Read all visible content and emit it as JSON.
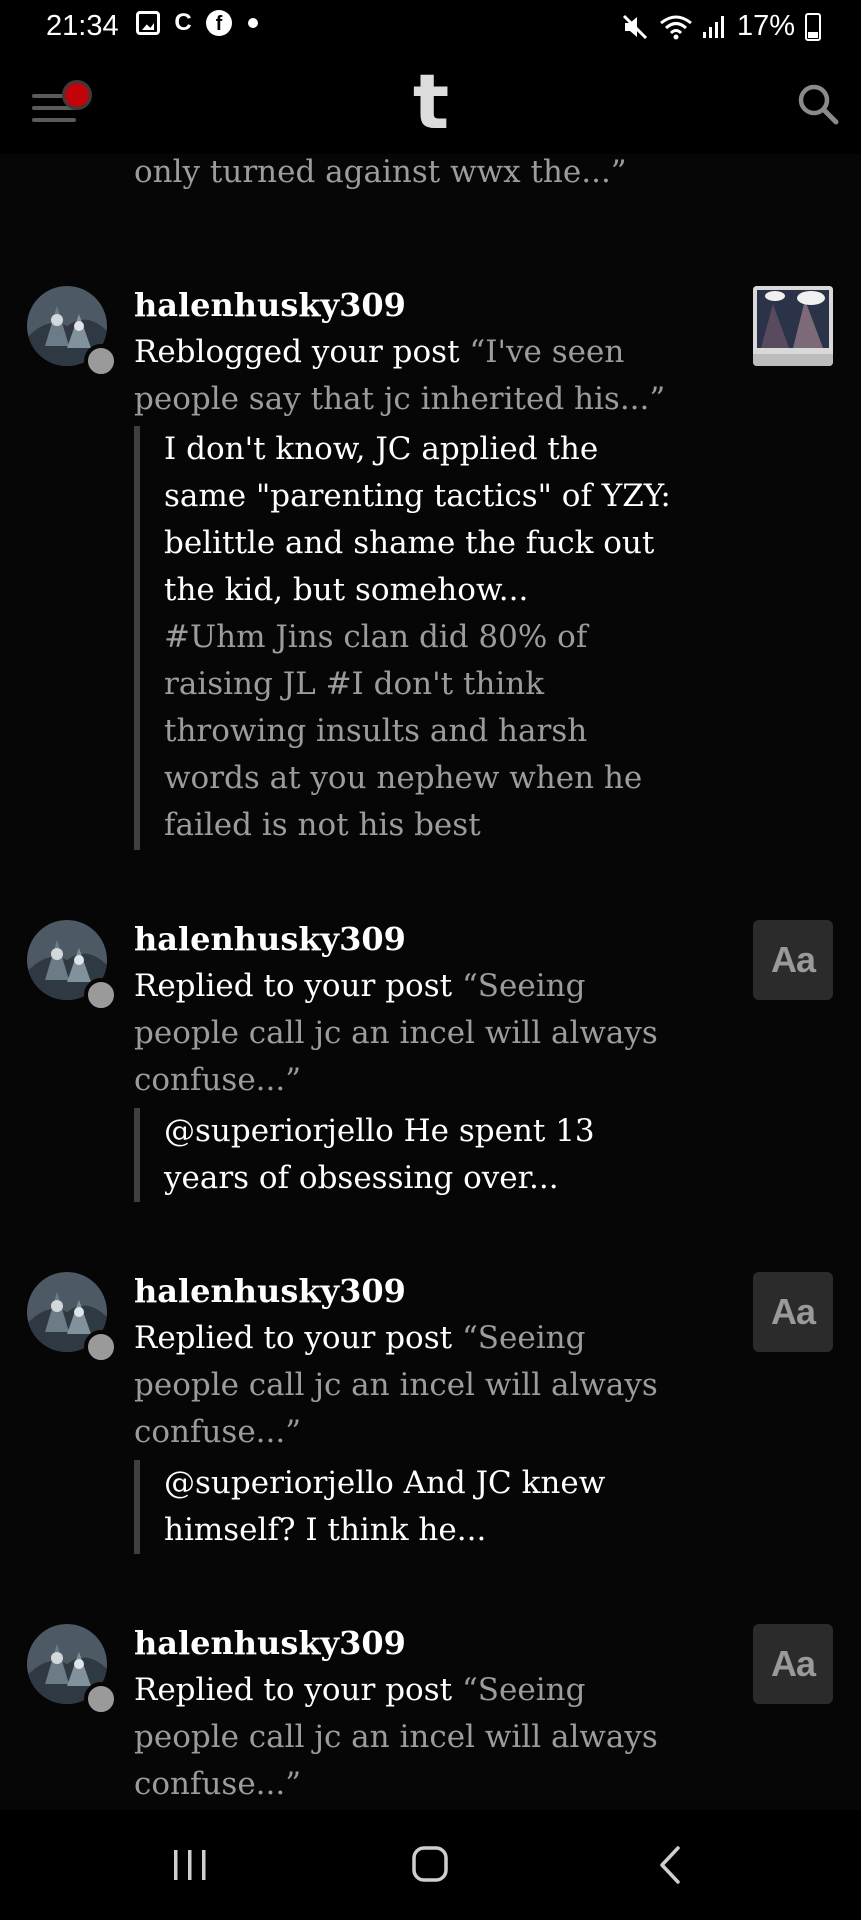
{
  "status_bar": {
    "time": "21:34",
    "notification_icons": [
      "image-icon",
      "c-app-icon",
      "facebook-icon",
      "dot-icon"
    ],
    "system_icons": [
      "mute-icon",
      "wifi-icon",
      "signal-icon",
      "battery-icon"
    ],
    "battery": "17%"
  },
  "app_header": {
    "logo": "t",
    "menu_icon": "hamburger-menu-icon",
    "search_icon": "search-icon",
    "badge_color": "#c0040a"
  },
  "activity": [
    {
      "truncated": true,
      "action_tail": "only turned against wwx the...”"
    },
    {
      "username": "halenhusky309",
      "action_verb": "Reblogged your post",
      "post_excerpt": "“I've seen people say that jc inherited his...”",
      "quote_text": "I don't know, JC applied the same \"parenting tactics\" of YZY: belittle and shame the fuck out the kid, but somehow...",
      "quote_tags": "#Uhm Jins clan did 80% of raising JL #I don't think throwing insults and harsh words at you nephew when he failed is not his best",
      "thumbnail": "image"
    },
    {
      "username": "halenhusky309",
      "action_verb": "Replied to your post",
      "post_excerpt": "“Seeing people call jc an incel will always confuse...”",
      "quote_text": "@superiorjello He spent 13 years of obsessing over...",
      "thumbnail": "Aa"
    },
    {
      "username": "halenhusky309",
      "action_verb": "Replied to your post",
      "post_excerpt": "“Seeing people call jc an incel will always confuse...”",
      "quote_text": "@superiorjello And JC knew himself? I think he...",
      "thumbnail": "Aa"
    },
    {
      "username": "halenhusky309",
      "action_verb": "Replied to your post",
      "post_excerpt": "“Seeing people call jc an incel will always confuse...”",
      "thumbnail": "Aa"
    }
  ],
  "nav_bar": {
    "buttons": [
      "recents-icon",
      "home-icon",
      "back-icon"
    ]
  }
}
